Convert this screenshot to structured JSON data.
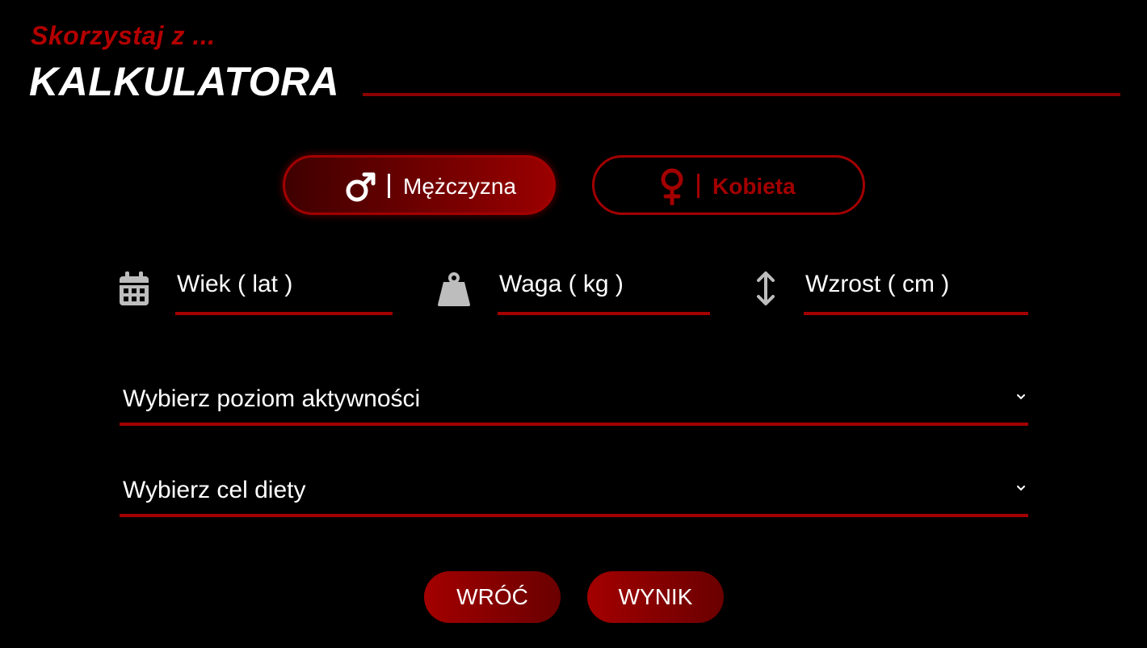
{
  "header": {
    "subtitle": "Skorzystaj z ...",
    "title": "KALKULATORA"
  },
  "gender": {
    "male_label": "Mężczyzna",
    "female_label": "Kobieta",
    "selected": "Mężczyzna"
  },
  "fields": {
    "age": "Wiek ( lat )",
    "weight": "Waga ( kg )",
    "height": "Wzrost ( cm )"
  },
  "selects": {
    "activity": "Wybierz poziom aktywności",
    "goal": "Wybierz cel diety"
  },
  "buttons": {
    "back": "WRÓĆ",
    "result": "WYNIK"
  },
  "colors": {
    "accent": "#a30000",
    "accent_text": "#b30000",
    "background": "#000000",
    "icon_gray": "#bdbdbd"
  },
  "icons": {
    "male": "male-symbol-icon",
    "female": "female-symbol-icon",
    "age": "calendar-icon",
    "weight": "weight-icon",
    "height": "vertical-arrows-icon",
    "chevron": "chevron-down-icon",
    "check": "check-icon"
  }
}
